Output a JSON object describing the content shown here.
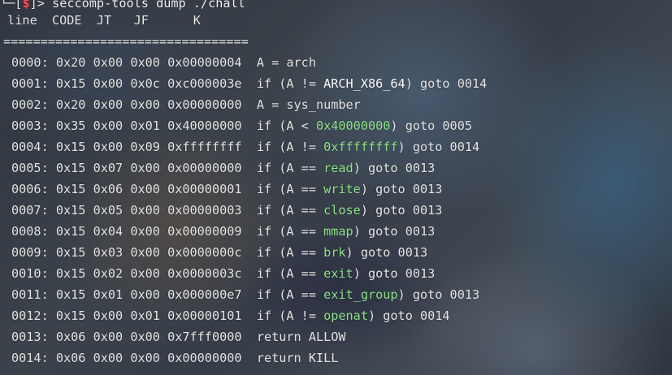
{
  "terminal": {
    "prompt": {
      "corner": "└─",
      "open_bracket": "[",
      "symbol": "$",
      "close_bracket": "]",
      "arrow": "> ",
      "command": "seccomp-tools dump ./chall"
    },
    "header": " line  CODE  JT   JF      K",
    "separator": "=================================",
    "rows": [
      {
        "addr": "0000:",
        "code": "0x20",
        "jt": "0x00",
        "jf": "0x00",
        "k": "0x00000004",
        "pre": "A = arch",
        "hl": "",
        "post": "",
        "hl_color": ""
      },
      {
        "addr": "0001:",
        "code": "0x15",
        "jt": "0x00",
        "jf": "0x0c",
        "k": "0xc000003e",
        "pre": "if (A != ",
        "hl": "ARCH_X86_64",
        "post": ") goto 0014",
        "hl_color": "white"
      },
      {
        "addr": "0002:",
        "code": "0x20",
        "jt": "0x00",
        "jf": "0x00",
        "k": "0x00000000",
        "pre": "A = sys_number",
        "hl": "",
        "post": "",
        "hl_color": ""
      },
      {
        "addr": "0003:",
        "code": "0x35",
        "jt": "0x00",
        "jf": "0x01",
        "k": "0x40000000",
        "pre": "if (A < ",
        "hl": "0x40000000",
        "post": ") goto 0005",
        "hl_color": "green"
      },
      {
        "addr": "0004:",
        "code": "0x15",
        "jt": "0x00",
        "jf": "0x09",
        "k": "0xffffffff",
        "pre": "if (A != ",
        "hl": "0xffffffff",
        "post": ") goto 0014",
        "hl_color": "green"
      },
      {
        "addr": "0005:",
        "code": "0x15",
        "jt": "0x07",
        "jf": "0x00",
        "k": "0x00000000",
        "pre": "if (A == ",
        "hl": "read",
        "post": ") goto 0013",
        "hl_color": "green"
      },
      {
        "addr": "0006:",
        "code": "0x15",
        "jt": "0x06",
        "jf": "0x00",
        "k": "0x00000001",
        "pre": "if (A == ",
        "hl": "write",
        "post": ") goto 0013",
        "hl_color": "green"
      },
      {
        "addr": "0007:",
        "code": "0x15",
        "jt": "0x05",
        "jf": "0x00",
        "k": "0x00000003",
        "pre": "if (A == ",
        "hl": "close",
        "post": ") goto 0013",
        "hl_color": "green"
      },
      {
        "addr": "0008:",
        "code": "0x15",
        "jt": "0x04",
        "jf": "0x00",
        "k": "0x00000009",
        "pre": "if (A == ",
        "hl": "mmap",
        "post": ") goto 0013",
        "hl_color": "green"
      },
      {
        "addr": "0009:",
        "code": "0x15",
        "jt": "0x03",
        "jf": "0x00",
        "k": "0x0000000c",
        "pre": "if (A == ",
        "hl": "brk",
        "post": ") goto 0013",
        "hl_color": "green"
      },
      {
        "addr": "0010:",
        "code": "0x15",
        "jt": "0x02",
        "jf": "0x00",
        "k": "0x0000003c",
        "pre": "if (A == ",
        "hl": "exit",
        "post": ") goto 0013",
        "hl_color": "green"
      },
      {
        "addr": "0011:",
        "code": "0x15",
        "jt": "0x01",
        "jf": "0x00",
        "k": "0x000000e7",
        "pre": "if (A == ",
        "hl": "exit_group",
        "post": ") goto 0013",
        "hl_color": "green"
      },
      {
        "addr": "0012:",
        "code": "0x15",
        "jt": "0x00",
        "jf": "0x01",
        "k": "0x00000101",
        "pre": "if (A != ",
        "hl": "openat",
        "post": ") goto 0014",
        "hl_color": "green"
      },
      {
        "addr": "0013:",
        "code": "0x06",
        "jt": "0x00",
        "jf": "0x00",
        "k": "0x7fff0000",
        "pre": "return ALLOW",
        "hl": "",
        "post": "",
        "hl_color": ""
      },
      {
        "addr": "0014:",
        "code": "0x06",
        "jt": "0x00",
        "jf": "0x00",
        "k": "0x00000000",
        "pre": "return KILL",
        "hl": "",
        "post": "",
        "hl_color": ""
      }
    ]
  },
  "colors": {
    "text": "#e6e6e6",
    "prompt_symbol": "#ff4d4d",
    "syscall_highlight": "#8fe389",
    "arch_highlight": "#ffffff"
  }
}
